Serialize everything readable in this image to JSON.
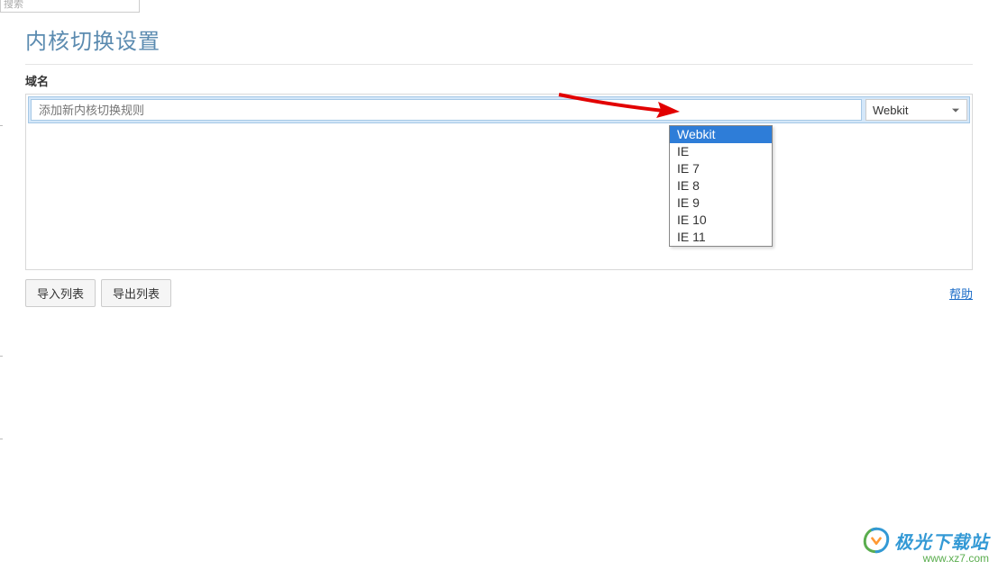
{
  "top_search_placeholder": "搜索",
  "page_title": "内核切换设置",
  "section_label": "域名",
  "rule_input_placeholder": "添加新内核切换规则",
  "engine_selected": "Webkit",
  "dropdown_options": [
    "Webkit",
    "IE",
    "IE 7",
    "IE 8",
    "IE 9",
    "IE 10",
    "IE 11"
  ],
  "dropdown_selected_index": 0,
  "import_btn": "导入列表",
  "export_btn": "导出列表",
  "help_link": "帮助",
  "watermark_text": "极光下载站",
  "watermark_url": "www.xz7.com"
}
